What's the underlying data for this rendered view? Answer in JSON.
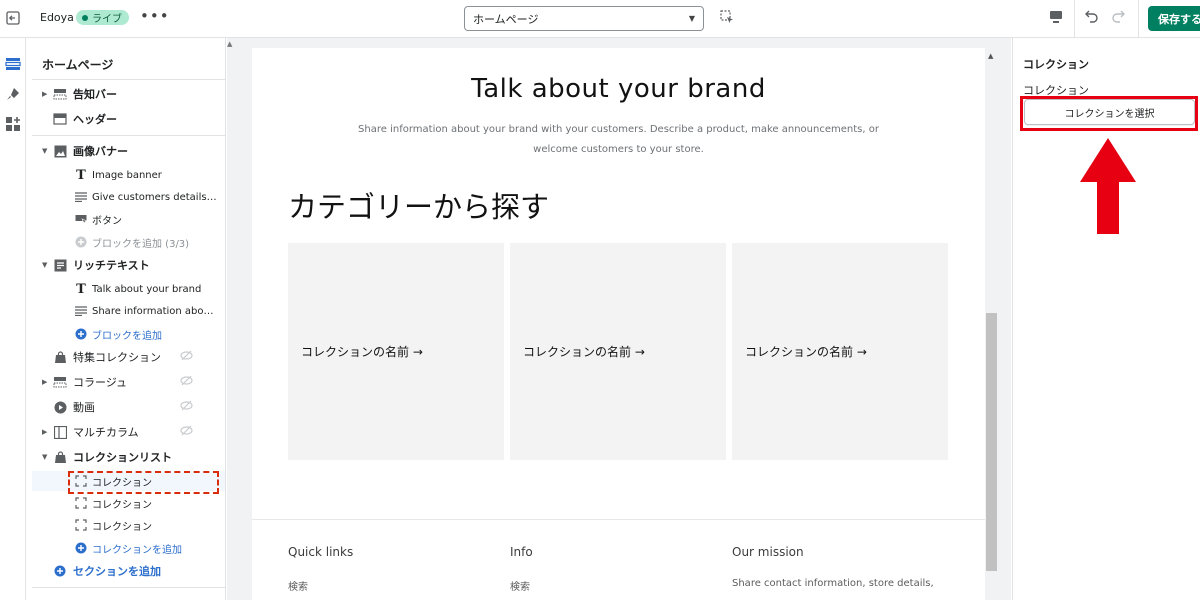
{
  "topbar": {
    "store_name": "Edoya",
    "live_badge": "ライブ",
    "more_label": "•••",
    "page_select_value": "ホームページ",
    "save_label": "保存する"
  },
  "sidebar": {
    "title": "ホームページ",
    "items": [
      {
        "label": "告知バー",
        "type": "section"
      },
      {
        "label": "ヘッダー",
        "type": "section"
      },
      {
        "label": "画像バナー",
        "type": "section"
      },
      {
        "label": "Image banner",
        "type": "block"
      },
      {
        "label": "Give customers details about...",
        "type": "block"
      },
      {
        "label": "ボタン",
        "type": "block"
      },
      {
        "label": "ブロックを追加 (3/3)",
        "type": "add-disabled"
      },
      {
        "label": "リッチテキスト",
        "type": "section"
      },
      {
        "label": "Talk about your brand",
        "type": "block"
      },
      {
        "label": "Share information about y...",
        "type": "block"
      },
      {
        "label": "ブロックを追加",
        "type": "add"
      },
      {
        "label": "特集コレクション",
        "type": "section-hidden"
      },
      {
        "label": "コラージュ",
        "type": "section-hidden"
      },
      {
        "label": "動画",
        "type": "section-hidden"
      },
      {
        "label": "マルチカラム",
        "type": "section-hidden"
      },
      {
        "label": "コレクションリスト",
        "type": "section"
      },
      {
        "label": "コレクション",
        "type": "block-selected"
      },
      {
        "label": "コレクション",
        "type": "block"
      },
      {
        "label": "コレクション",
        "type": "block"
      },
      {
        "label": "コレクションを追加",
        "type": "add"
      },
      {
        "label": "セクションを追加",
        "type": "add-section"
      }
    ]
  },
  "preview": {
    "hero_title": "Talk about your brand",
    "hero_text": "Share information about your brand with your customers. Describe a product, make announcements, or welcome customers to your store.",
    "collection_heading": "カテゴリーから探す",
    "cards": [
      {
        "label": "コレクションの名前 →"
      },
      {
        "label": "コレクションの名前 →"
      },
      {
        "label": "コレクションの名前 →"
      }
    ],
    "footer": {
      "col1_heading": "Quick links",
      "col1_item": "検索",
      "col2_heading": "Info",
      "col2_item": "検索",
      "col3_heading": "Our mission",
      "col3_item": "Share contact information, store details,"
    }
  },
  "settings": {
    "title": "コレクション",
    "field_label": "コレクション",
    "select_button": "コレクションを選択"
  },
  "colors": {
    "accent_green": "#008060",
    "highlight_red": "#e60012",
    "link_blue": "#2c6ecb"
  }
}
